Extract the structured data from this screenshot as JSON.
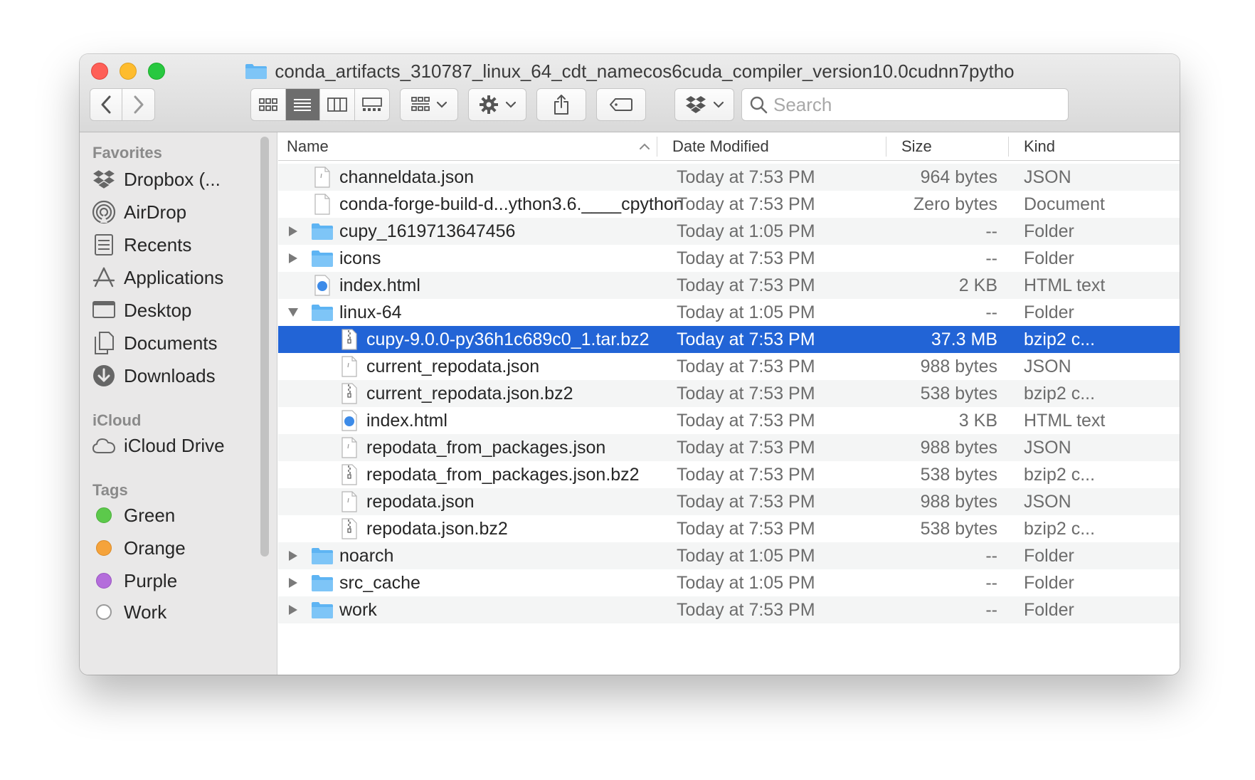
{
  "window": {
    "title": "conda_artifacts_310787_linux_64_cdt_namecos6cuda_compiler_version10.0cudnn7pytho"
  },
  "toolbar": {
    "back_icon": "chevron-left-icon",
    "forward_icon": "chevron-right-icon",
    "view_modes": [
      "icon-view-icon",
      "list-view-icon",
      "column-view-icon",
      "gallery-view-icon"
    ],
    "active_view": "list-view-icon",
    "group_icon": "group-by-icon",
    "action_icon": "gear-icon",
    "share_icon": "share-icon",
    "tag_icon": "tag-icon",
    "dropbox_icon": "dropbox-icon"
  },
  "search": {
    "placeholder": "Search",
    "value": ""
  },
  "sidebar": {
    "favorites_header": "Favorites",
    "favorites": [
      {
        "label": "Dropbox (...",
        "icon": "dropbox-icon"
      },
      {
        "label": "AirDrop",
        "icon": "airdrop-icon"
      },
      {
        "label": "Recents",
        "icon": "recents-icon"
      },
      {
        "label": "Applications",
        "icon": "applications-icon"
      },
      {
        "label": "Desktop",
        "icon": "desktop-icon"
      },
      {
        "label": "Documents",
        "icon": "documents-icon"
      },
      {
        "label": "Downloads",
        "icon": "downloads-icon"
      }
    ],
    "icloud_header": "iCloud",
    "icloud": [
      {
        "label": "iCloud Drive",
        "icon": "cloud-icon"
      }
    ],
    "tags_header": "Tags",
    "tags": [
      {
        "label": "Green",
        "color": "#5cc94b"
      },
      {
        "label": "Orange",
        "color": "#f5a33b"
      },
      {
        "label": "Purple",
        "color": "#b46ddb"
      },
      {
        "label": "Work",
        "color": "#ffffff"
      }
    ]
  },
  "columns": {
    "name": "Name",
    "date": "Date Modified",
    "size": "Size",
    "kind": "Kind"
  },
  "files": [
    {
      "name": "channeldata.json",
      "date": "Today at 7:53 PM",
      "size": "964 bytes",
      "kind": "JSON",
      "type": "json",
      "level": 0,
      "disclosure": "none"
    },
    {
      "name": "conda-forge-build-d...ython3.6.____cpython",
      "date": "Today at 7:53 PM",
      "size": "Zero bytes",
      "kind": "Document",
      "type": "doc",
      "level": 0,
      "disclosure": "none"
    },
    {
      "name": "cupy_1619713647456",
      "date": "Today at 1:05 PM",
      "size": "--",
      "kind": "Folder",
      "type": "folder",
      "level": 0,
      "disclosure": "collapsed"
    },
    {
      "name": "icons",
      "date": "Today at 7:53 PM",
      "size": "--",
      "kind": "Folder",
      "type": "folder",
      "level": 0,
      "disclosure": "collapsed"
    },
    {
      "name": "index.html",
      "date": "Today at 7:53 PM",
      "size": "2 KB",
      "kind": "HTML text",
      "type": "html",
      "level": 0,
      "disclosure": "none"
    },
    {
      "name": "linux-64",
      "date": "Today at 1:05 PM",
      "size": "--",
      "kind": "Folder",
      "type": "folder",
      "level": 0,
      "disclosure": "expanded"
    },
    {
      "name": "cupy-9.0.0-py36h1c689c0_1.tar.bz2",
      "date": "Today at 7:53 PM",
      "size": "37.3 MB",
      "kind": "bzip2 c...",
      "type": "archive",
      "level": 1,
      "disclosure": "none",
      "selected": true
    },
    {
      "name": "current_repodata.json",
      "date": "Today at 7:53 PM",
      "size": "988 bytes",
      "kind": "JSON",
      "type": "json",
      "level": 1,
      "disclosure": "none"
    },
    {
      "name": "current_repodata.json.bz2",
      "date": "Today at 7:53 PM",
      "size": "538 bytes",
      "kind": "bzip2 c...",
      "type": "archive",
      "level": 1,
      "disclosure": "none"
    },
    {
      "name": "index.html",
      "date": "Today at 7:53 PM",
      "size": "3 KB",
      "kind": "HTML text",
      "type": "html",
      "level": 1,
      "disclosure": "none"
    },
    {
      "name": "repodata_from_packages.json",
      "date": "Today at 7:53 PM",
      "size": "988 bytes",
      "kind": "JSON",
      "type": "json",
      "level": 1,
      "disclosure": "none"
    },
    {
      "name": "repodata_from_packages.json.bz2",
      "date": "Today at 7:53 PM",
      "size": "538 bytes",
      "kind": "bzip2 c...",
      "type": "archive",
      "level": 1,
      "disclosure": "none"
    },
    {
      "name": "repodata.json",
      "date": "Today at 7:53 PM",
      "size": "988 bytes",
      "kind": "JSON",
      "type": "json",
      "level": 1,
      "disclosure": "none"
    },
    {
      "name": "repodata.json.bz2",
      "date": "Today at 7:53 PM",
      "size": "538 bytes",
      "kind": "bzip2 c...",
      "type": "archive",
      "level": 1,
      "disclosure": "none"
    },
    {
      "name": "noarch",
      "date": "Today at 1:05 PM",
      "size": "--",
      "kind": "Folder",
      "type": "folder",
      "level": 0,
      "disclosure": "collapsed"
    },
    {
      "name": "src_cache",
      "date": "Today at 1:05 PM",
      "size": "--",
      "kind": "Folder",
      "type": "folder",
      "level": 0,
      "disclosure": "collapsed"
    },
    {
      "name": "work",
      "date": "Today at 7:53 PM",
      "size": "--",
      "kind": "Folder",
      "type": "folder",
      "level": 0,
      "disclosure": "collapsed"
    }
  ],
  "colors": {
    "selection": "#2264d6",
    "folder": "#5eb4f3",
    "sidebar_bg": "#e9e8e8"
  }
}
